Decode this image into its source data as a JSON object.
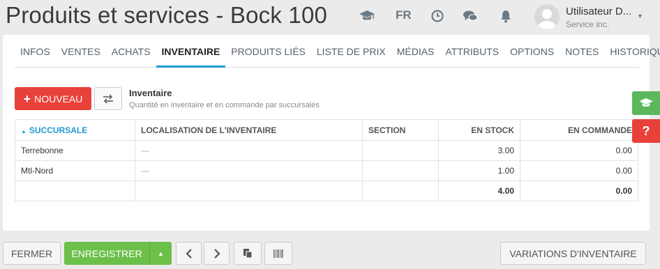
{
  "header": {
    "title": "Produits et services - Bock 100",
    "lang": "FR",
    "user_name": "Utilisateur D...",
    "user_company": "Service inc."
  },
  "tabs": [
    "INFOS",
    "VENTES",
    "ACHATS",
    "INVENTAIRE",
    "PRODUITS LIÉS",
    "LISTE DE PRIX",
    "MÉDIAS",
    "ATTRIBUTS",
    "OPTIONS",
    "NOTES",
    "HISTORIQUE"
  ],
  "active_tab": "INVENTAIRE",
  "toolbar": {
    "new_label": "NOUVEAU",
    "section_title": "Inventaire",
    "section_subtitle": "Quantité en inventaire et en commande par succursales"
  },
  "table": {
    "headers": [
      "SUCCURSALE",
      "LOCALISATION DE L'INVENTAIRE",
      "SECTION",
      "EN STOCK",
      "EN COMMANDE"
    ],
    "rows": [
      [
        "Terrebonne",
        "---",
        "",
        "3.00",
        "0.00"
      ],
      [
        "Mtl-Nord",
        "---",
        "",
        "1.00",
        "0.00"
      ]
    ],
    "totals": [
      "",
      "",
      "",
      "4.00",
      "0.00"
    ]
  },
  "side": {
    "help_symbol": "?"
  },
  "footer": {
    "close_label": "FERMER",
    "save_label": "ENREGISTRER",
    "variations_label": "VARIATIONS D'INVENTAIRE"
  },
  "colors": {
    "accent": "#1e9ad6",
    "danger": "#e8413a",
    "success": "#6cc04a"
  }
}
